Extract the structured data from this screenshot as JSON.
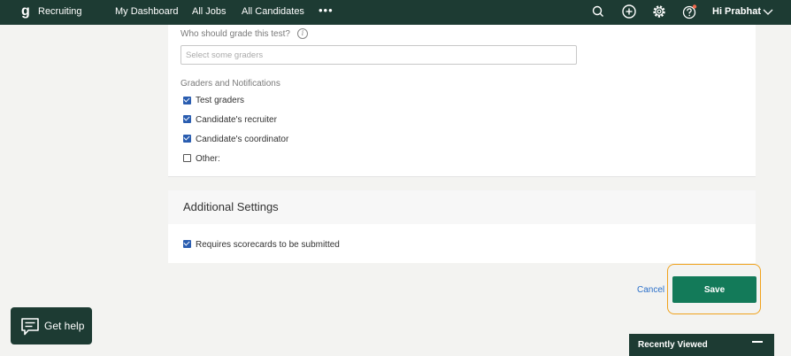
{
  "topbar": {
    "logo_glyph": "g",
    "brand": "Recruiting",
    "nav": [
      "My Dashboard",
      "All Jobs",
      "All Candidates"
    ],
    "more": "•••",
    "user_label": "Hi Prabhat",
    "icons": [
      "search-icon",
      "add-icon",
      "settings-icon",
      "help-icon",
      "chevron-down-icon"
    ]
  },
  "graders": {
    "question": "Who should grade this test?",
    "info_glyph": "i",
    "placeholder": "Select some graders"
  },
  "notifications": {
    "heading": "Graders and Notifications",
    "options": [
      {
        "label": "Test graders",
        "checked": true
      },
      {
        "label": "Candidate's recruiter",
        "checked": true
      },
      {
        "label": "Candidate's coordinator",
        "checked": true
      },
      {
        "label": "Other:",
        "checked": false
      }
    ]
  },
  "additional": {
    "title": "Additional Settings",
    "scorecard_label": "Requires scorecards to be submitted",
    "scorecard_checked": true
  },
  "actions": {
    "cancel": "Cancel",
    "save": "Save"
  },
  "help": {
    "label": "Get help"
  },
  "recently_viewed": {
    "label": "Recently Viewed"
  },
  "colors": {
    "topbar": "#1d3b33",
    "save": "#137a59",
    "checkbox": "#2a5db0",
    "highlight_ring": "#f0a21c",
    "link": "#2a6fc9"
  }
}
